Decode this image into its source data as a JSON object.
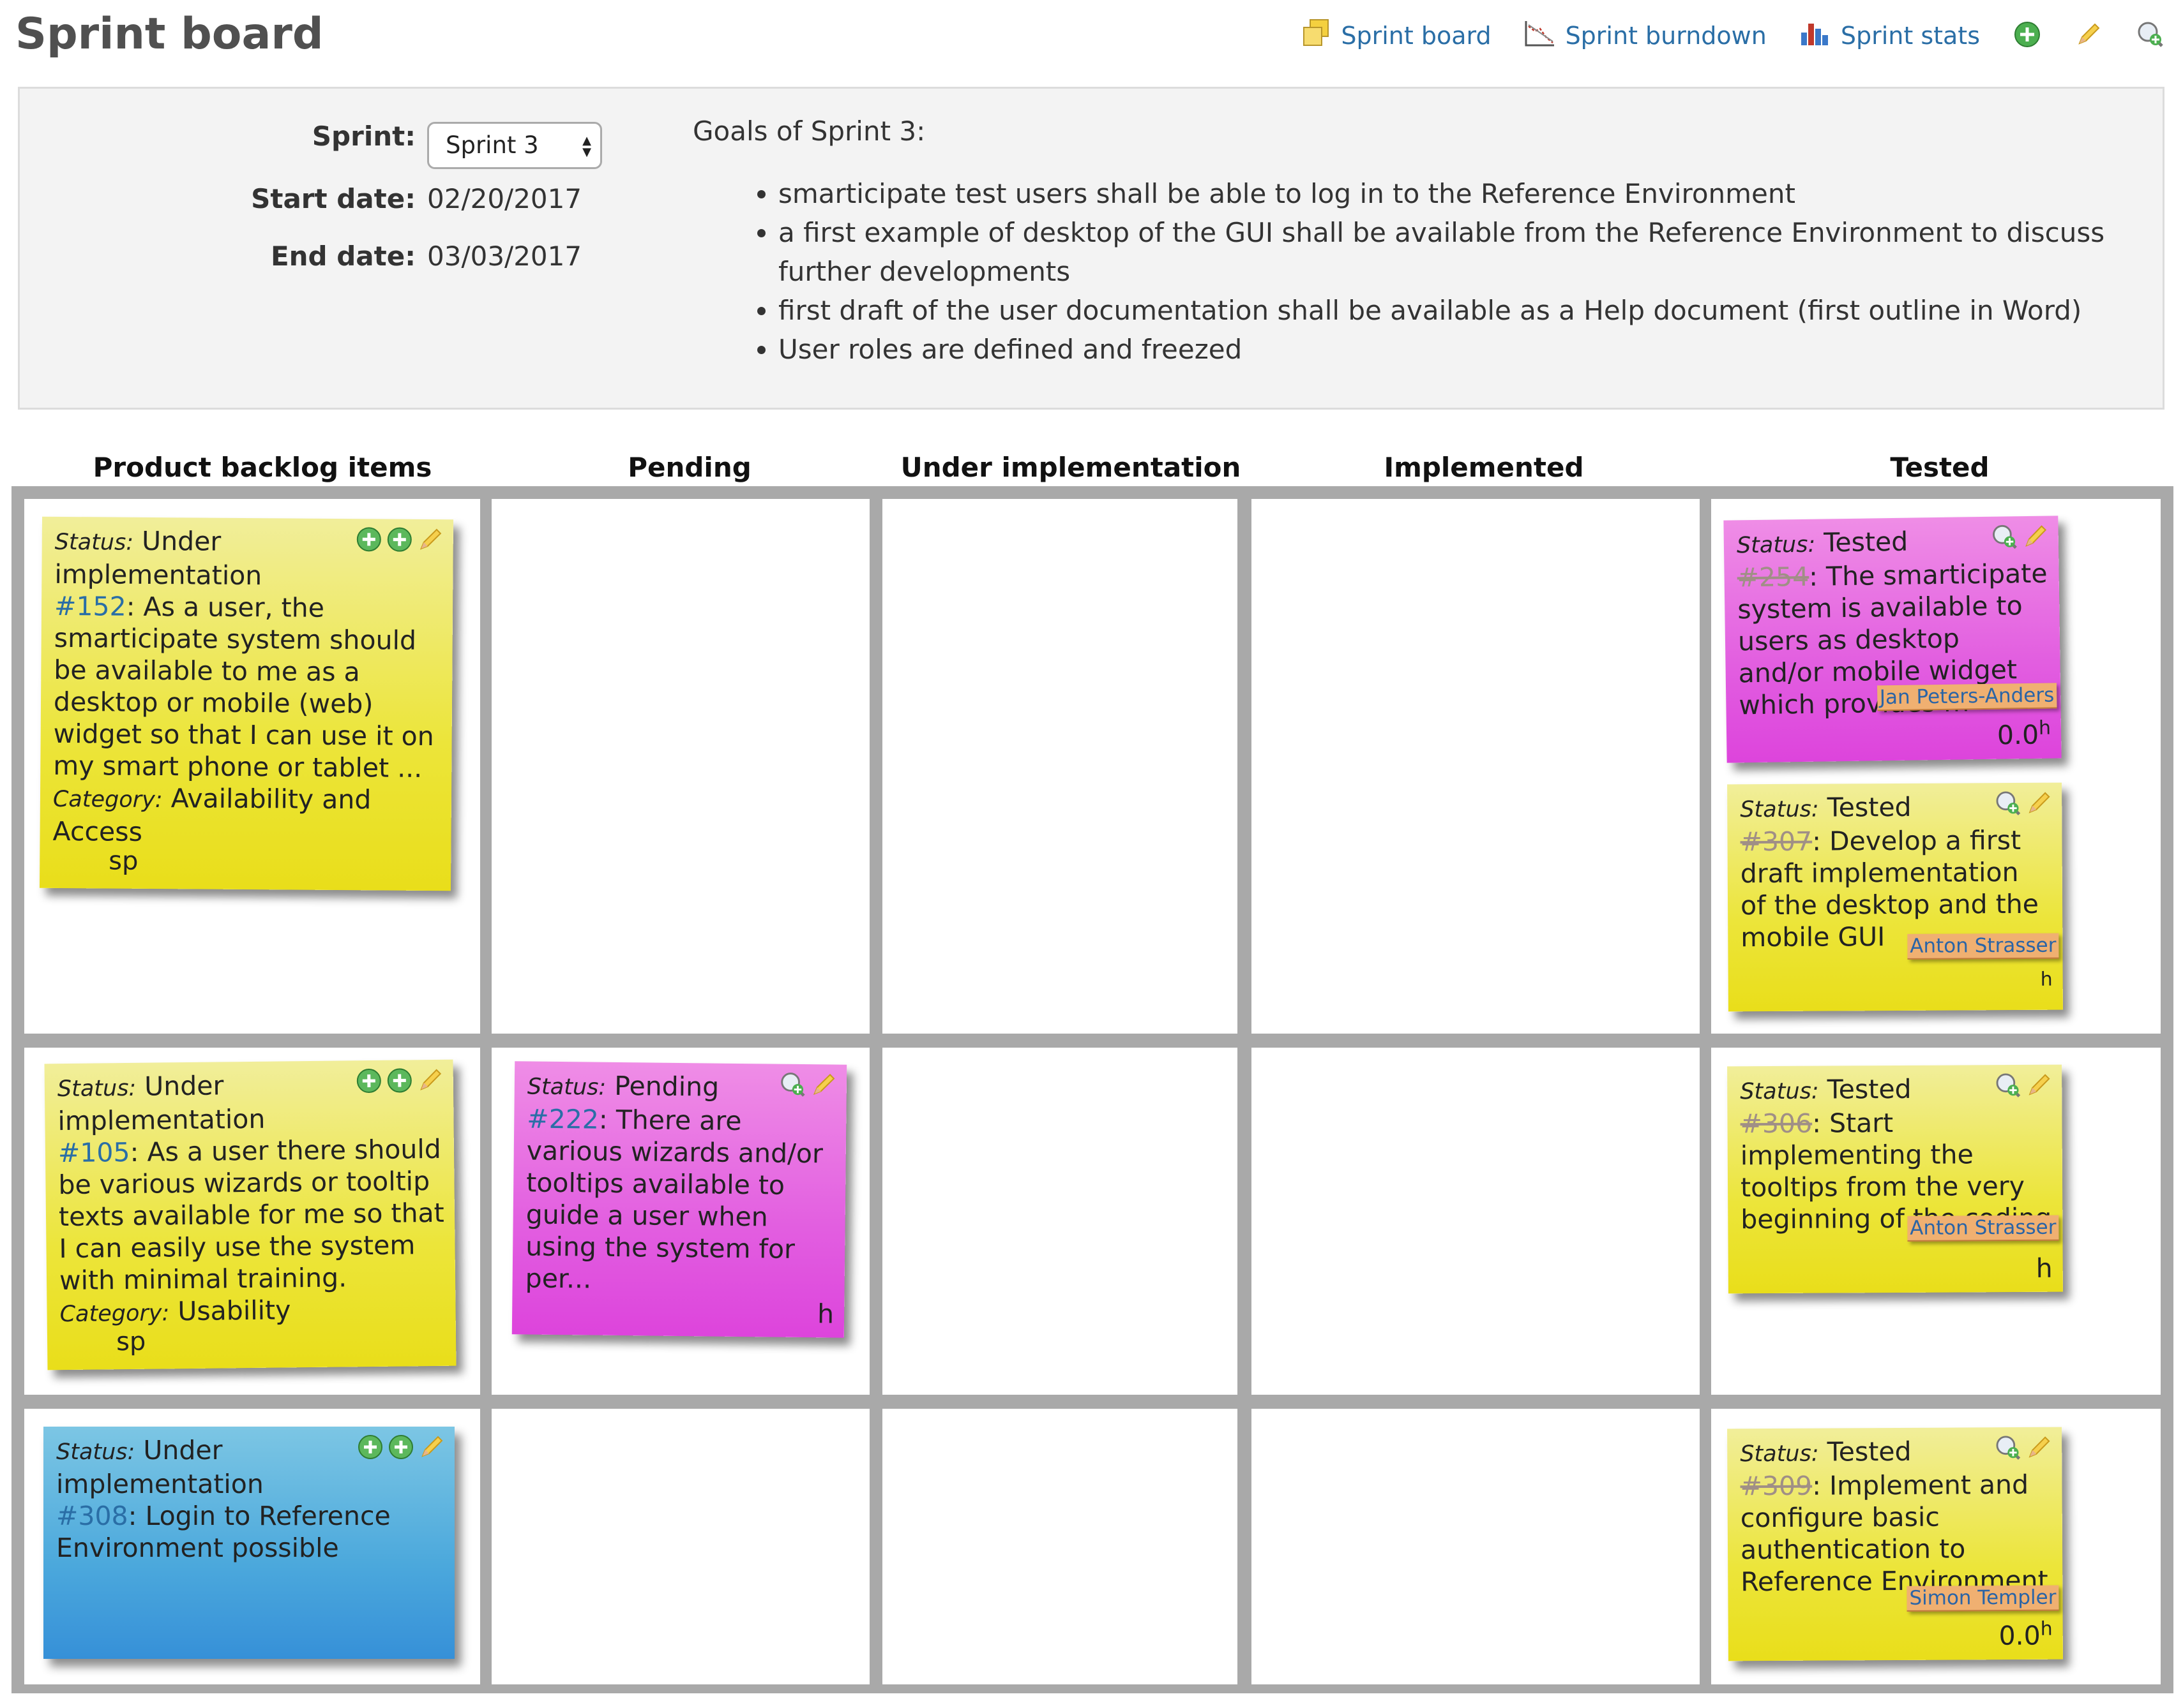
{
  "page": {
    "title": "Sprint board"
  },
  "nav": {
    "sprint_board": "Sprint board",
    "sprint_burndown": "Sprint burndown",
    "sprint_stats": "Sprint stats",
    "icons": [
      "add-icon",
      "edit-icon",
      "zoom-icon"
    ]
  },
  "sprint_info": {
    "sprint_label": "Sprint:",
    "sprint_selected": "Sprint 3",
    "start_label": "Start date:",
    "start_value": "02/20/2017",
    "end_label": "End date:",
    "end_value": "03/03/2017",
    "goals_title": "Goals of Sprint 3:",
    "goals": [
      "smarticipate test users shall be able to log in to the Reference Environment",
      "a first example of desktop of the GUI shall be available from the Reference Environment to discuss further developments",
      "first draft of the user documentation shall be available as a Help document (first outline in Word)",
      "User roles are defined and freezed"
    ]
  },
  "columns": [
    "Product backlog items",
    "Pending",
    "Under implementation",
    "Implemented",
    "Tested"
  ],
  "cards": {
    "c152": {
      "status_label": "Status:",
      "status": "Under",
      "status2": "implementation",
      "id": "#152",
      "text": ": As a user, the smarticipate system should be available to me as a desktop or mobile (web) widget so that I can use it on my smart phone or tablet ...",
      "category_label": "Category:",
      "category": "Availability and Access",
      "points": "sp"
    },
    "c254": {
      "status_label": "Status:",
      "status": "Tested",
      "id": "#254",
      "text": ": The smarticipate system is available to users as desktop and/or mobile widget which provides m",
      "assignee": "Jan Peters-Anders",
      "hours": "0.0",
      "hours_unit": "h"
    },
    "c307": {
      "status_label": "Status:",
      "status": "Tested",
      "id": "#307",
      "text": ": Develop a first draft implementation of the desktop and the mobile GUI",
      "assignee": "Anton Strasser",
      "hours_unit": "h"
    },
    "c105": {
      "status_label": "Status:",
      "status": "Under",
      "status2": "implementation",
      "id": "#105",
      "text": ": As a user there should be various wizards or tooltip texts available for me so that I can easily use the system with minimal training.",
      "category_label": "Category:",
      "category": "Usability",
      "points": "sp"
    },
    "c222": {
      "status_label": "Status:",
      "status": "Pending",
      "id": "#222",
      "text": ": There are various wizards and/or tooltips available to guide a user when using the system for per...",
      "hours_unit": "h"
    },
    "c306": {
      "status_label": "Status:",
      "status": "Tested",
      "id": "#306",
      "text": ": Start implementing the tooltips from the very beginning of the coding",
      "assignee": "Anton Strasser",
      "hours_unit": "h"
    },
    "c308": {
      "status_label": "Status:",
      "status": "Under",
      "status2": "implementation",
      "id": "#308",
      "text": ": Login to Reference Environment possible"
    },
    "c309": {
      "status_label": "Status:",
      "status": "Tested",
      "id": "#309",
      "text": ": Implement and configure basic authentication to Reference Environment",
      "assignee": "Simon Templer",
      "hours": "0.0",
      "hours_unit": "h"
    }
  },
  "colors": {
    "yellow": "#ece53a",
    "pink": "#e25ee0",
    "blue": "#4ba8dc",
    "link": "#2a6ea6",
    "grid": "#a9a9a9"
  }
}
